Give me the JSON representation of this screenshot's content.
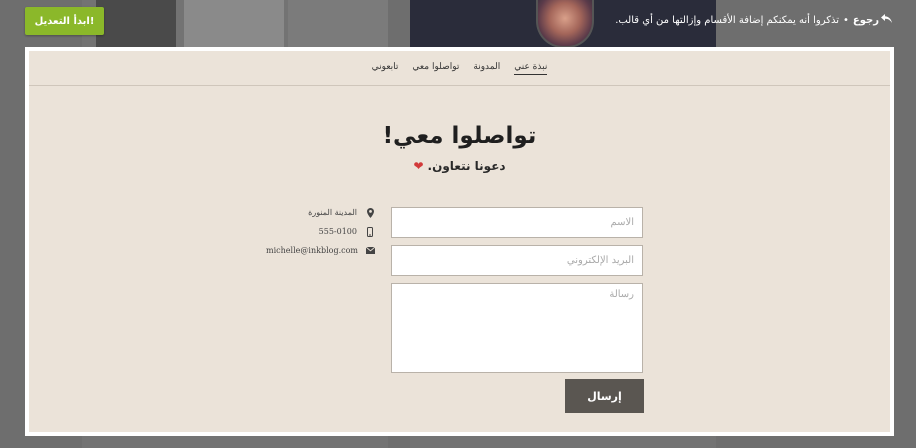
{
  "topbar": {
    "start_button_label": "ابدأ التعديل!",
    "back_label": "رجوع",
    "notice_text": "تذكروا أنه يمكنكم إضافة الأقسام وإزالتها من أي قالب."
  },
  "nav": {
    "items": [
      {
        "label": "نبذة عني",
        "active": true
      },
      {
        "label": "المدونة",
        "active": false
      },
      {
        "label": "تواصلوا معي",
        "active": false
      },
      {
        "label": "تابعوني",
        "active": false
      }
    ]
  },
  "contact": {
    "title": "تواصلوا معي!",
    "subtitle": "دعونا نتعاون.",
    "info": [
      {
        "icon": "location-pin-icon",
        "text": "المدينة المنورة"
      },
      {
        "icon": "phone-icon",
        "text": "555-0100"
      },
      {
        "icon": "envelope-icon",
        "text": "michelle@inkblog.com"
      }
    ],
    "form": {
      "name_placeholder": "الاسم",
      "email_placeholder": "البريد الإلكتروني",
      "message_placeholder": "رسالة",
      "send_label": "إرسال"
    }
  },
  "colors": {
    "accent_green": "#8bb82a",
    "page_bg": "#ebe3d9",
    "send_button": "#5a5651",
    "heart": "#d23a3a"
  }
}
